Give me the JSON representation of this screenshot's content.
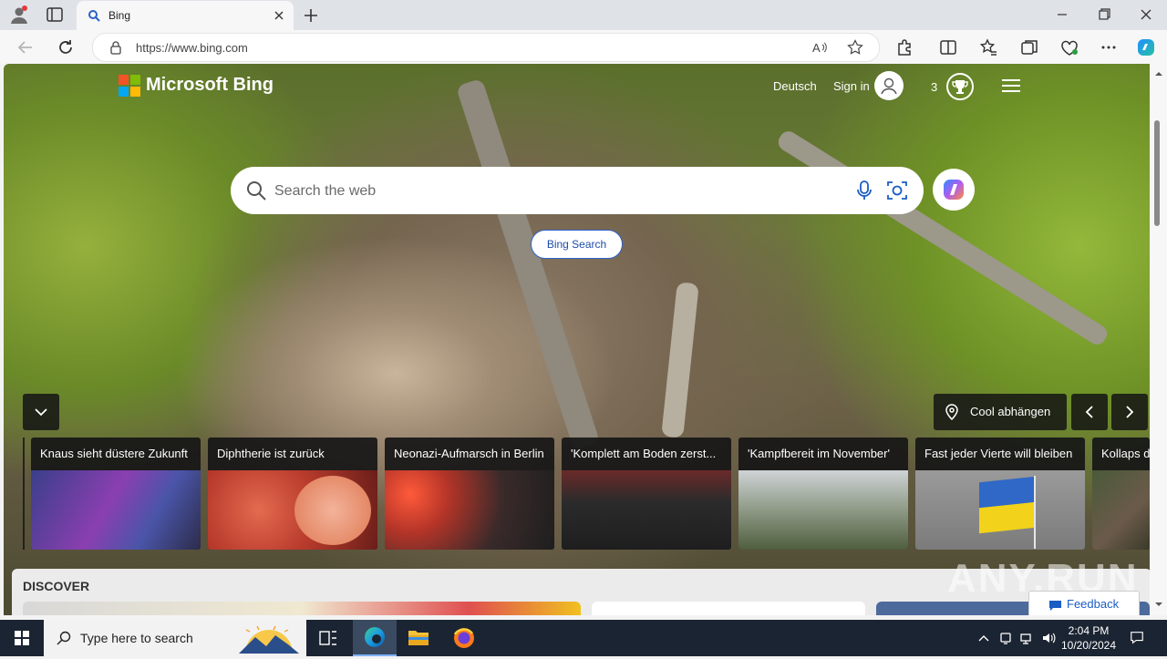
{
  "browser": {
    "tab_title": "Bing",
    "url": "https://www.bing.com",
    "new_tab_symbol": "+"
  },
  "bing": {
    "brand": "Microsoft Bing",
    "language": "Deutsch",
    "sign_in": "Sign in",
    "rewards_count": "3",
    "search_placeholder": "Search the web",
    "search_button": "Bing Search",
    "location_label": "Cool abhängen",
    "news": [
      {
        "title": "Knaus sieht düstere Zukunft"
      },
      {
        "title": "Diphtherie ist zurück"
      },
      {
        "title": "Neonazi-Aufmarsch in Berlin"
      },
      {
        "title": "'Komplett am Boden zerst..."
      },
      {
        "title": "'Kampfbereit im November'"
      },
      {
        "title": "Fast jeder Vierte will bleiben"
      },
      {
        "title": "Kollaps d"
      }
    ],
    "discover_label": "DISCOVER",
    "feedback_label": "Feedback",
    "watermark": "ANY.RUN"
  },
  "taskbar": {
    "search_placeholder": "Type here to search",
    "time": "2:04 PM",
    "date": "10/20/2024"
  },
  "colors": {
    "accent": "#2b61c8",
    "taskbar": "#1b2432",
    "tabbar": "#dfe3e8"
  }
}
